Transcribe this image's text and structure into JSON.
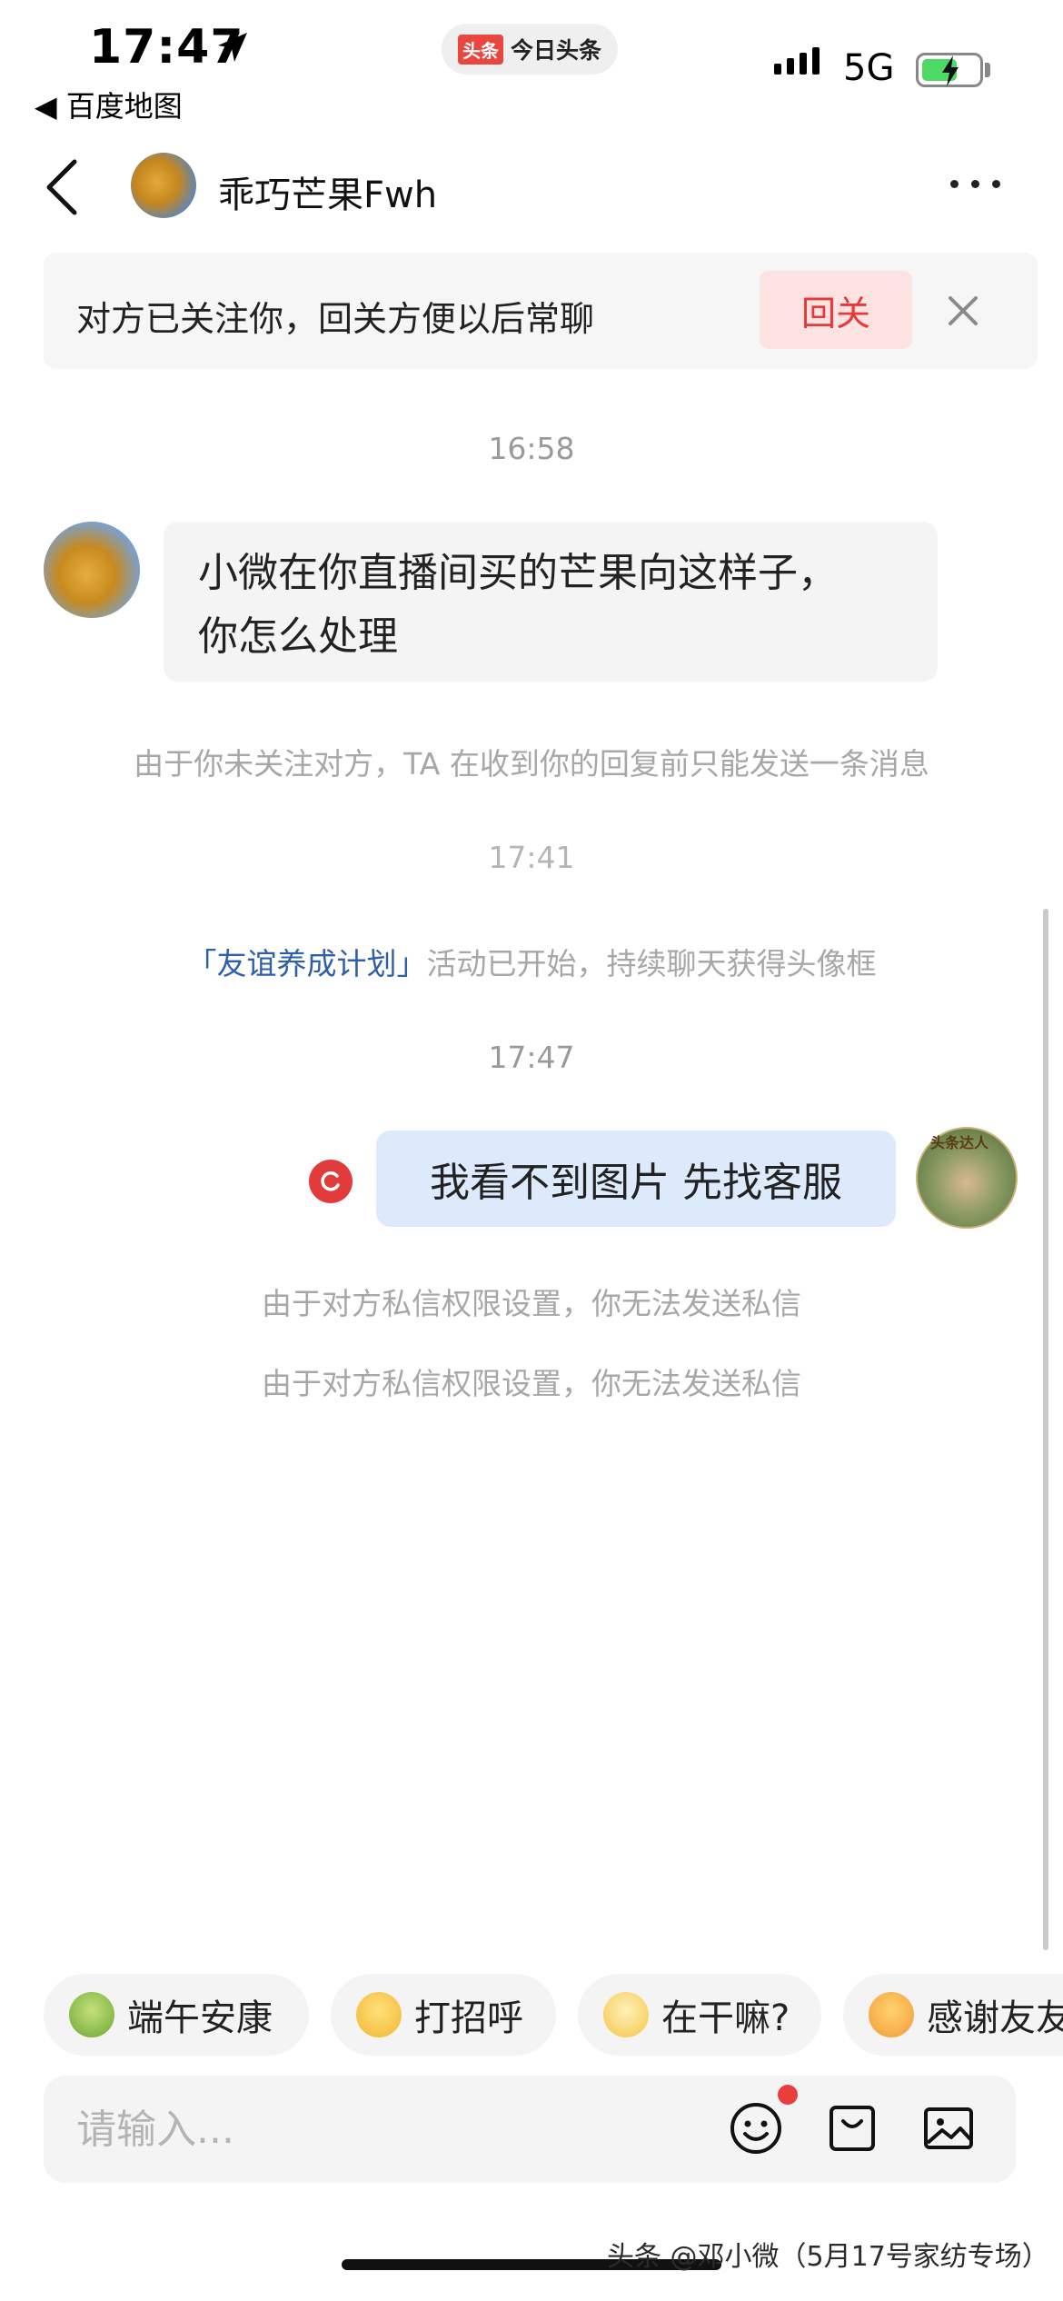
{
  "status_bar": {
    "time": "17:47",
    "back_app": "◀ 百度地图",
    "center_pill_logo": "头条",
    "center_pill_text": "今日头条",
    "network": "5G"
  },
  "header": {
    "contact_name": "乖巧芒果Fwh"
  },
  "follow_banner": {
    "text": "对方已关注你，回关方便以后常聊",
    "button": "回关"
  },
  "messages": {
    "ts1": "16:58",
    "incoming_text_line1": "小微在你直播间买的芒果向这样子，",
    "incoming_text_line2": "你怎么处理",
    "notice_limit": "由于你未关注对方，TA 在收到你的回复前只能发送一条消息",
    "ts2": "17:41",
    "activity_link": "「友谊养成计划」",
    "activity_rest": "活动已开始，持续聊天获得头像框",
    "ts3": "17:47",
    "outgoing_text": "我看不到图片 先找客服",
    "avatar_tag": "头条达人",
    "notice_privacy_1": "由于对方私信权限设置，你无法发送私信",
    "notice_privacy_2": "由于对方私信权限设置，你无法发送私信"
  },
  "quick_replies": [
    {
      "label": "端午安康",
      "icon": "zongzi-emoji"
    },
    {
      "label": "打招呼",
      "icon": "wave-emoji"
    },
    {
      "label": "在干嘛?",
      "icon": "curious-emoji"
    },
    {
      "label": "感谢友友",
      "icon": "grateful-emoji"
    }
  ],
  "input": {
    "placeholder": "请输入..."
  },
  "watermark": "头条 @邓小微（5月17号家纺专场）",
  "colors": {
    "accent_red": "#e63a3a",
    "link_blue": "#2f5fa8",
    "outgoing_bubble": "#ddeafc",
    "incoming_bubble": "#f4f4f5"
  }
}
